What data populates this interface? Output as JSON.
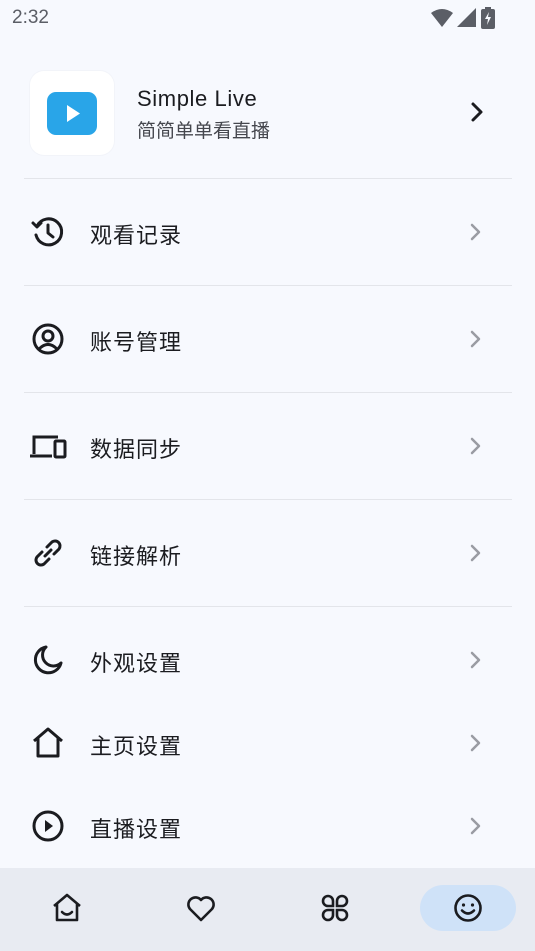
{
  "status_bar": {
    "time": "2:32",
    "icons": [
      "wifi-icon",
      "signal-icon",
      "battery-charging-icon"
    ]
  },
  "app_header": {
    "name": "Simple Live",
    "subtitle": "简简单单看直播",
    "logo_color": "#29a5e8"
  },
  "menu": {
    "items": [
      {
        "label": "观看记录",
        "icon": "history-icon"
      },
      {
        "label": "账号管理",
        "icon": "account-icon"
      },
      {
        "label": "数据同步",
        "icon": "devices-icon"
      },
      {
        "label": "链接解析",
        "icon": "link-icon"
      },
      {
        "label": "外观设置",
        "icon": "moon-icon"
      },
      {
        "label": "主页设置",
        "icon": "home-outline-icon"
      },
      {
        "label": "直播设置",
        "icon": "play-circle-icon"
      }
    ]
  },
  "bottom_nav": {
    "items": [
      {
        "icon": "home-icon",
        "active": false
      },
      {
        "icon": "heart-icon",
        "active": false
      },
      {
        "icon": "category-icon",
        "active": false
      },
      {
        "icon": "smile-icon",
        "active": true
      }
    ],
    "active_color": "#cfe2f8",
    "background": "#e8ebf2"
  },
  "colors": {
    "background": "#f7f9fe",
    "text": "#1b1c20",
    "chevron": "#9a9ca3"
  }
}
